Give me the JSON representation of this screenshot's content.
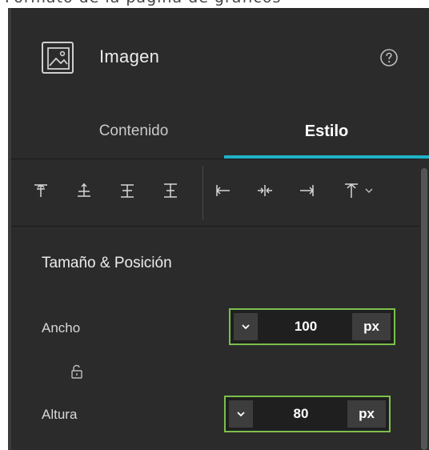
{
  "top_text": "Formato de la página de gráficos",
  "panel": {
    "title": "Imagen",
    "icons": {
      "header": "image-icon",
      "help": "help-icon"
    }
  },
  "tabs": [
    {
      "label": "Contenido",
      "active": false
    },
    {
      "label": "Estilo",
      "active": true
    }
  ],
  "toolbar": {
    "buttons": [
      "align-top-icon",
      "align-middle-icon",
      "align-bottom-icon",
      "distribute-vertical-icon",
      "align-left-icon",
      "align-center-icon",
      "align-right-icon",
      "arrange-to-top-icon"
    ],
    "dropdown_icon": "chevron-down-icon"
  },
  "size_position": {
    "title": "Tamaño & Posición",
    "width": {
      "label": "Ancho",
      "value": "100",
      "unit": "px"
    },
    "height": {
      "label": "Altura",
      "value": "80",
      "unit": "px"
    },
    "lock_icon": "lock-icon"
  },
  "colors": {
    "panel_bg": "#2b2b2b",
    "accent": "#1fb2c8",
    "focus_border": "#7cc04b"
  }
}
